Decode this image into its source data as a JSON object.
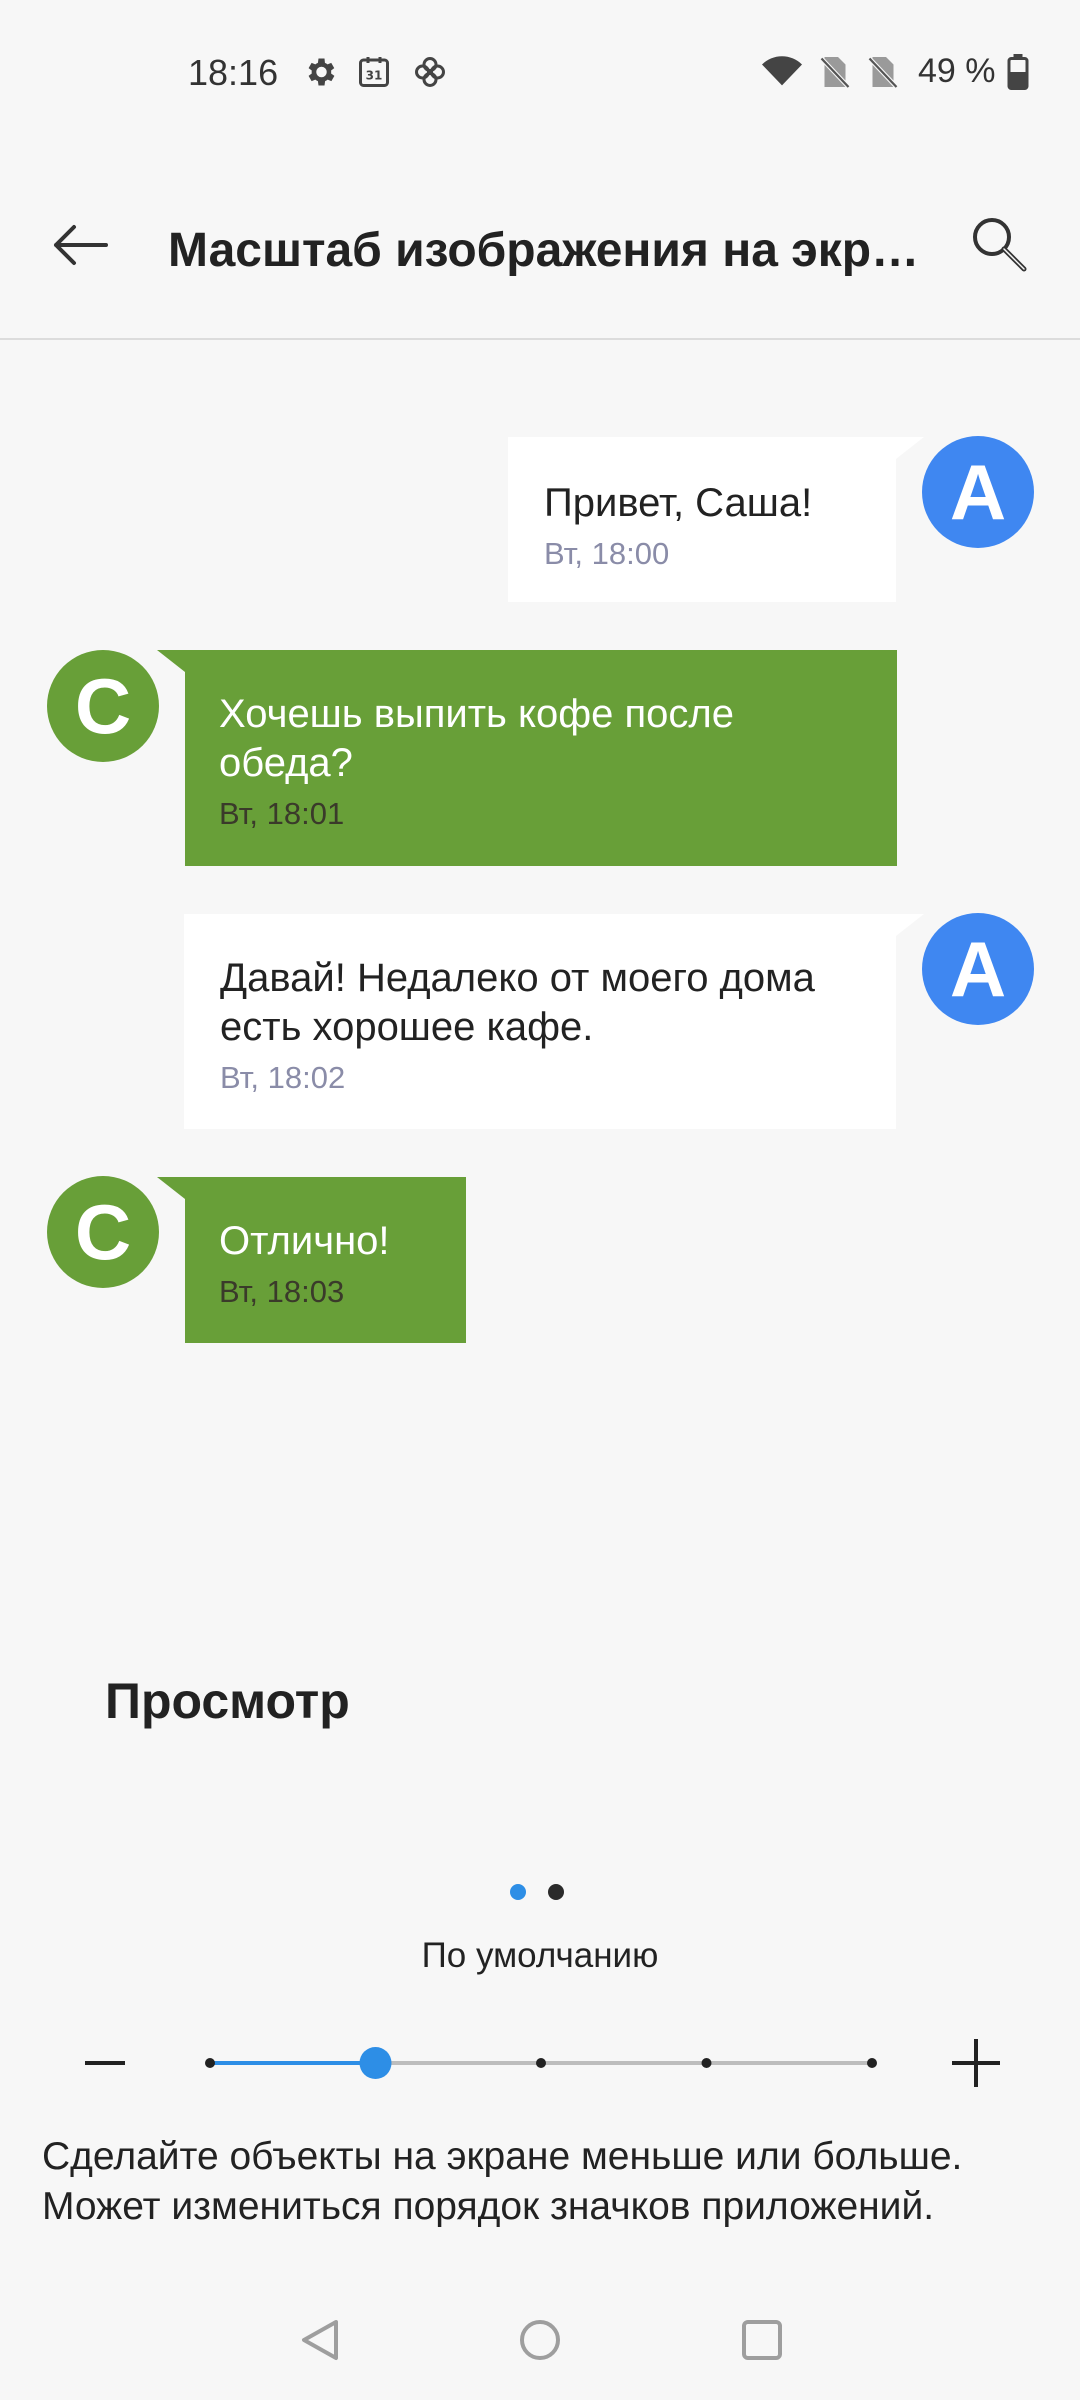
{
  "status_bar": {
    "time": "18:16",
    "battery": "49 %",
    "icons": [
      "settings-gear-icon",
      "calendar-icon",
      "pinwheel-icon",
      "wifi-icon",
      "no-sim-icon",
      "no-sim-icon",
      "battery-icon"
    ],
    "calendar_day": "31"
  },
  "app_bar": {
    "title": "Масштаб изображения на экране",
    "back_icon": "arrow-back-icon",
    "search_icon": "search-icon"
  },
  "chat_preview": {
    "messages": [
      {
        "sender": "A",
        "direction": "outgoing",
        "text": "Привет, Саша!",
        "time": "Вт, 18:00"
      },
      {
        "sender": "C",
        "direction": "incoming",
        "text": "Хочешь выпить кофе после обеда?",
        "time": "Вт, 18:01"
      },
      {
        "sender": "A",
        "direction": "outgoing",
        "text": "Давай! Недалеко от моего дома есть хорошее кафе.",
        "time": "Вт, 18:02"
      },
      {
        "sender": "C",
        "direction": "incoming",
        "text": "Отлично!",
        "time": "Вт, 18:03"
      }
    ]
  },
  "preview": {
    "label": "Просмотр",
    "page_count": 2,
    "active_page": 1
  },
  "scale": {
    "current_label": "По умолчанию",
    "steps": 5,
    "selected_step": 2,
    "minus_icon": "minus-icon",
    "plus_icon": "plus-icon"
  },
  "description": "Сделайте объекты на экране меньше или больше. Может измениться порядок значков приложений.",
  "nav_bar": {
    "icons": [
      "nav-back-icon",
      "nav-home-icon",
      "nav-recents-icon"
    ]
  },
  "colors": {
    "accent": "#2d8ee6",
    "avatar_a": "#3f87f1",
    "incoming_bubble": "#689f38",
    "outgoing_bubble": "#ffffff",
    "background": "#f7f7f7"
  }
}
